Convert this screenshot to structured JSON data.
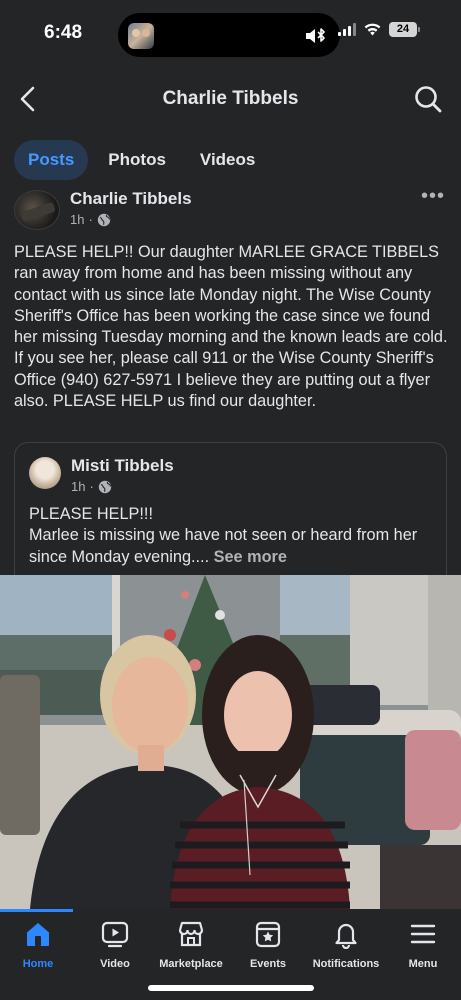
{
  "status_bar": {
    "time": "6:48",
    "battery": "24"
  },
  "header": {
    "title": "Charlie Tibbels",
    "back_icon": "chevron-left-icon",
    "search_icon": "search-icon"
  },
  "tabs": [
    {
      "label": "Posts",
      "active": true
    },
    {
      "label": "Photos",
      "active": false
    },
    {
      "label": "Videos",
      "active": false
    }
  ],
  "post": {
    "author": "Charlie Tibbels",
    "time": "1h",
    "audience_icon": "globe-icon",
    "more_label": "•••",
    "text": "PLEASE HELP!!  Our daughter MARLEE GRACE TIBBELS ran away  from home and has been missing without any contact with us since late Monday night. The Wise County Sheriff's Office has been working the case since we found her missing Tuesday morning and the known leads are cold.  If you see her, please call 911 or the Wise County Sheriff's Office (940) 627-5971  I believe they are putting out a flyer also.  PLEASE HELP us find our daughter.",
    "shared": {
      "author": "Misti Tibbels",
      "time": "1h",
      "text_line1": "PLEASE HELP!!!",
      "text_body": "Marlee is missing we have not seen or heard from her since Monday evening.... ",
      "see_more": "See more"
    }
  },
  "bottom_nav": [
    {
      "label": "Home",
      "icon": "home-icon",
      "active": true
    },
    {
      "label": "Video",
      "icon": "video-icon",
      "active": false
    },
    {
      "label": "Marketplace",
      "icon": "marketplace-icon",
      "active": false
    },
    {
      "label": "Events",
      "icon": "events-icon",
      "active": false
    },
    {
      "label": "Notifications",
      "icon": "bell-icon",
      "active": false
    },
    {
      "label": "Menu",
      "icon": "menu-icon",
      "active": false
    }
  ],
  "colors": {
    "background": "#242526",
    "accent": "#2d88ff",
    "active_tab_bg": "#263951",
    "text": "#e4e6eb",
    "secondary_text": "#b0b3b8"
  }
}
